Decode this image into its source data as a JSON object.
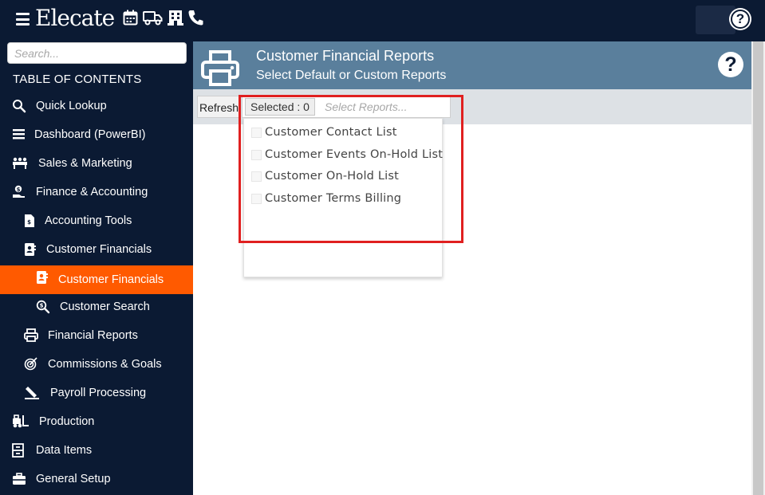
{
  "app": {
    "logo": "Elecate"
  },
  "top_icons": [
    "calendar-icon",
    "truck-icon",
    "building-icon",
    "phone-icon"
  ],
  "sidebar": {
    "search_placeholder": "Search...",
    "toc_label": "TABLE OF CONTENTS",
    "items": [
      {
        "label": "Quick Lookup",
        "icon": "search-icon"
      },
      {
        "label": "Dashboard (PowerBI)",
        "icon": "list-icon"
      },
      {
        "label": "Sales & Marketing",
        "icon": "team-icon"
      },
      {
        "label": "Finance & Accounting",
        "icon": "money-hand-icon"
      },
      {
        "label": "Accounting Tools",
        "icon": "invoice-icon"
      },
      {
        "label": "Customer Financials",
        "icon": "contact-book-icon"
      },
      {
        "label": "Customer Financials",
        "icon": "contact-book-icon",
        "active": true
      },
      {
        "label": "Customer Search",
        "icon": "search-dollar-icon"
      },
      {
        "label": "Financial Reports",
        "icon": "printer-icon"
      },
      {
        "label": "Commissions & Goals",
        "icon": "target-icon"
      },
      {
        "label": "Payroll Processing",
        "icon": "signature-icon"
      },
      {
        "label": "Production",
        "icon": "forklift-icon"
      },
      {
        "label": "Data Items",
        "icon": "cabinet-icon"
      },
      {
        "label": "General Setup",
        "icon": "toolbox-icon"
      }
    ]
  },
  "header": {
    "title": "Customer Financial Reports",
    "subtitle": "Select Default or Custom Reports",
    "help": "?"
  },
  "toolbar": {
    "refresh_label": "Refresh",
    "selected_label": "Selected : 0",
    "select_placeholder": "Select Reports..."
  },
  "dropdown": {
    "options": [
      "Customer Contact List",
      "Customer Events On-Hold List",
      "Customer On-Hold List",
      "Customer Terms Billing"
    ]
  },
  "colors": {
    "navy": "#0b1a33",
    "accent": "#ff5a00",
    "header_band": "#5a7f9c",
    "highlight": "#e02020"
  }
}
